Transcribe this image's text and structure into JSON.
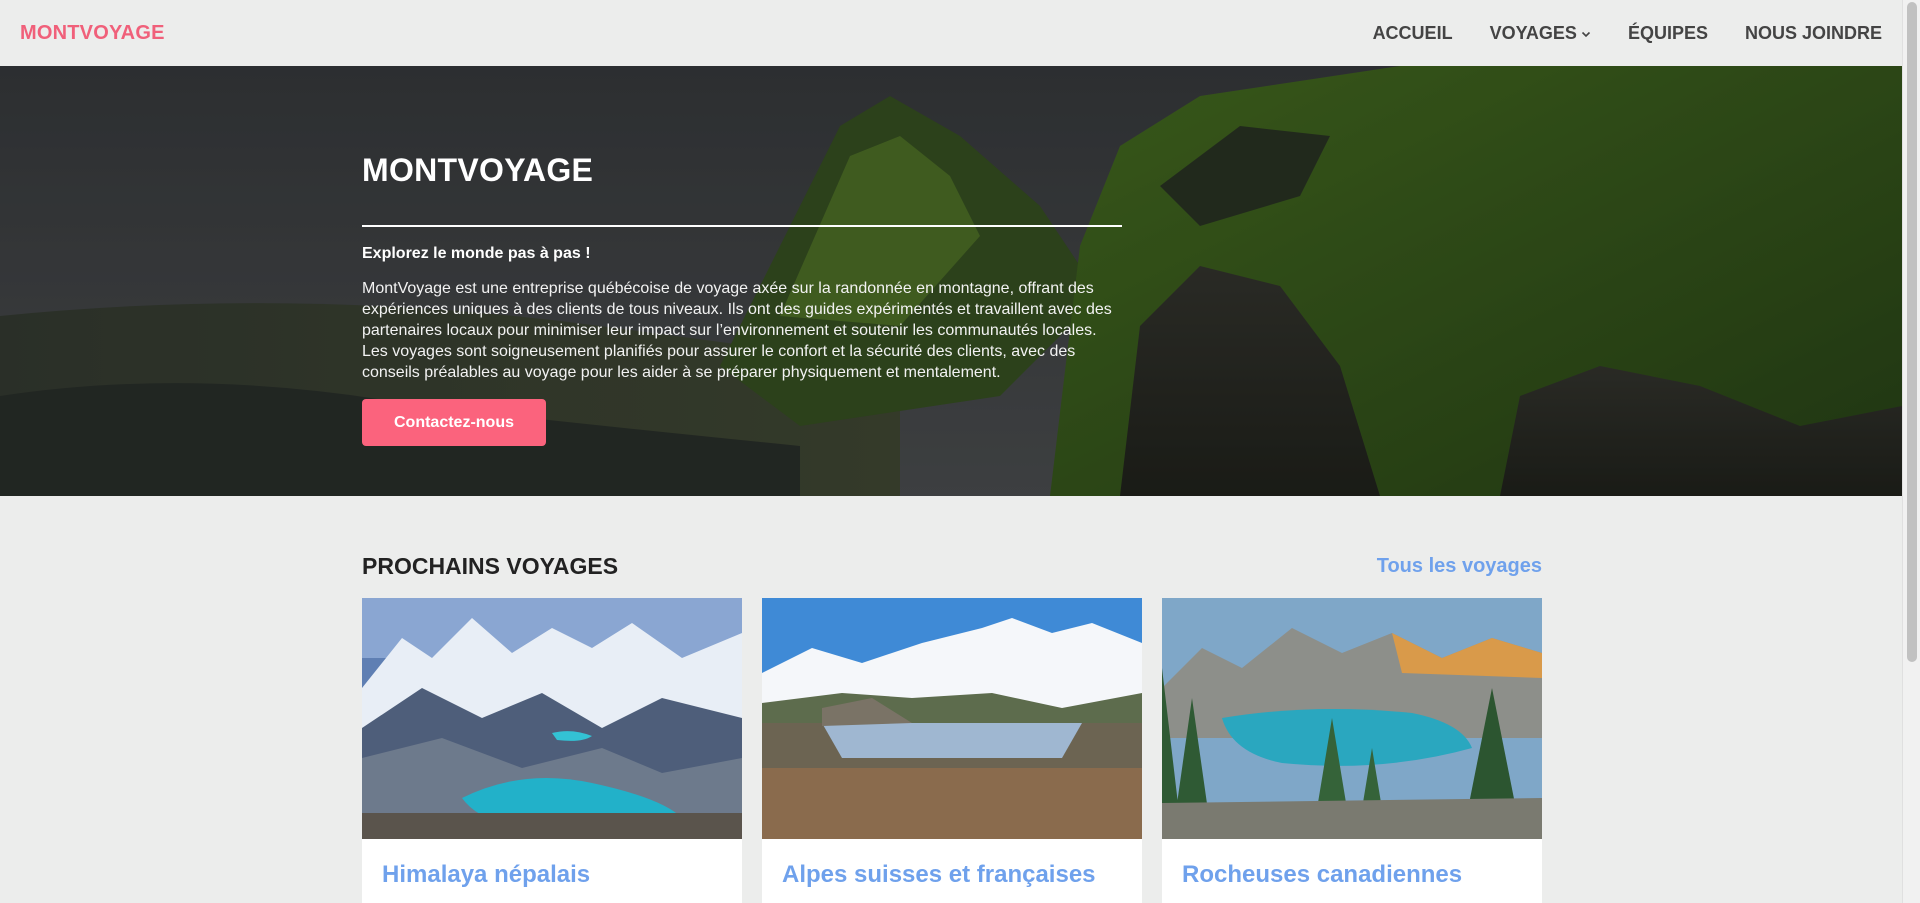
{
  "navbar": {
    "brand": "MONTVOYAGE",
    "links": [
      {
        "label": "ACCUEIL"
      },
      {
        "label": "VOYAGES",
        "icon": "chevron-down-icon"
      },
      {
        "label": "ÉQUIPES"
      },
      {
        "label": "NOUS JOINDRE"
      }
    ]
  },
  "hero": {
    "title": "MONTVOYAGE",
    "tagline": "Explorez le monde pas à pas !",
    "description": "MontVoyage est une entreprise québécoise de voyage axée sur la randonnée en montagne, offrant des expériences uniques à des clients de tous niveaux. Ils ont des guides expérimentés et travaillent avec des partenaires locaux pour minimiser leur impact sur l’environnement et soutenir les communautés locales. Les voyages sont soigneusement planifiés pour assurer le confort et la sécurité des clients, avec des conseils préalables au voyage pour les aider à se préparer physiquement et mentalement.",
    "cta_label": "Contactez-nous"
  },
  "section": {
    "title": "PROCHAINS VOYAGES",
    "all_link": "Tous les voyages"
  },
  "trips": [
    {
      "title": "Himalaya népalais",
      "image": "himalaya-lake-photo"
    },
    {
      "title": "Alpes suisses et françaises",
      "image": "alps-reflection-photo"
    },
    {
      "title": "Rocheuses canadiennes",
      "image": "rockies-lake-photo"
    }
  ],
  "colors": {
    "accent": "#fb637d",
    "brand": "#f0607a",
    "link": "#6fa1ec",
    "background": "#ecedec"
  }
}
